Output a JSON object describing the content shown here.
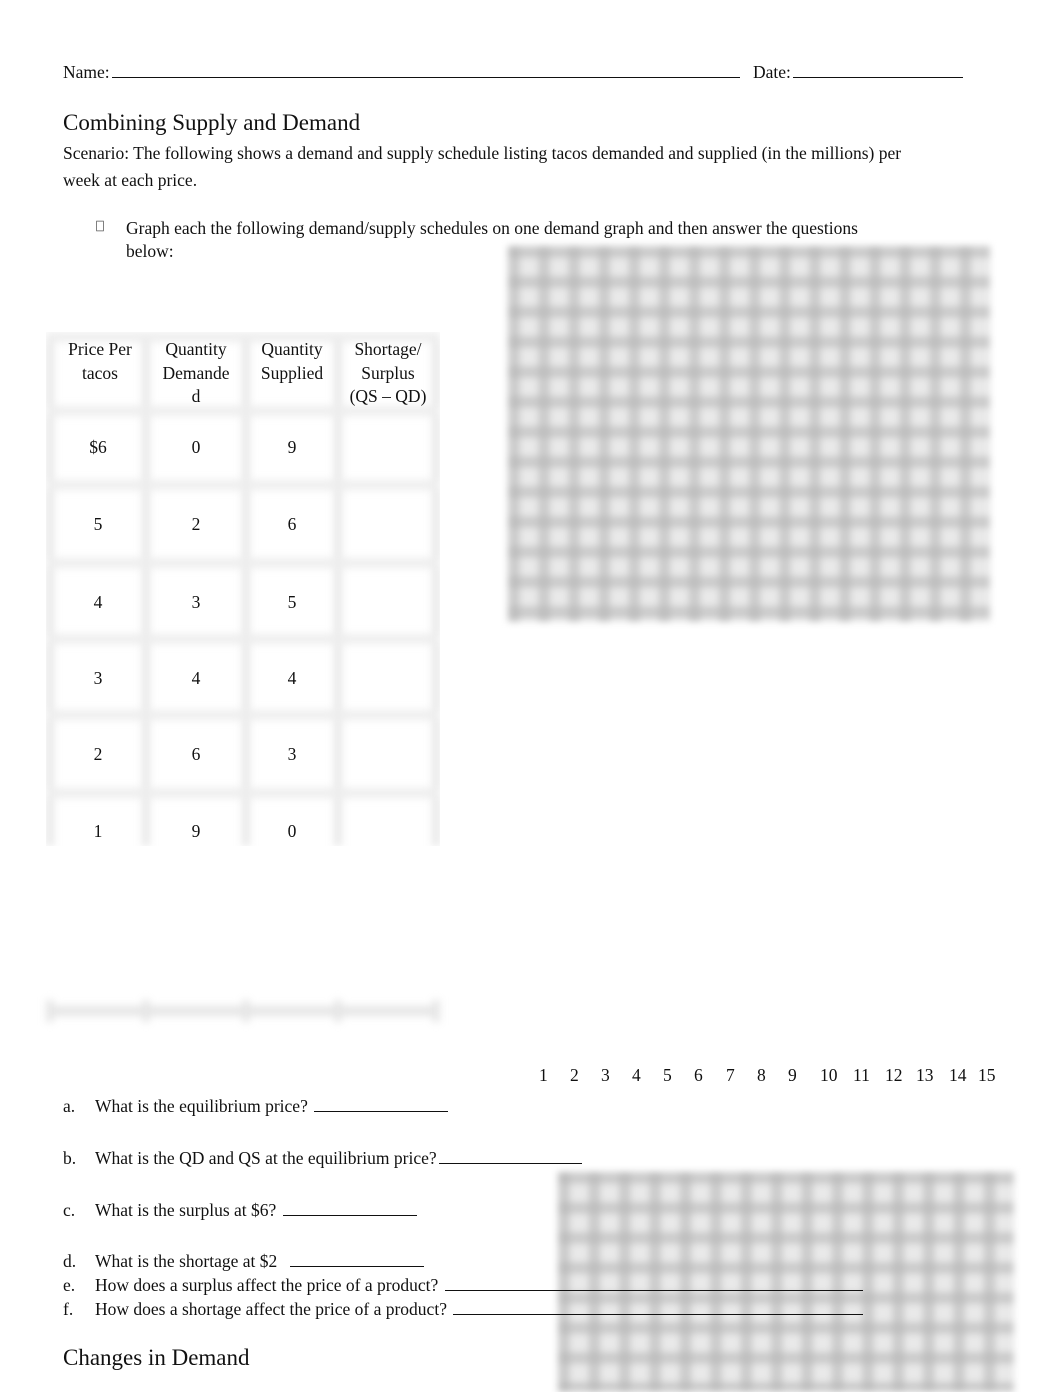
{
  "header": {
    "name_label": "Name:",
    "date_label": "Date:"
  },
  "section1": {
    "title": "Combining Supply and Demand",
    "scenario_line1": "Scenario: The following shows a demand and supply schedule listing tacos demanded and supplied (in the millions) per",
    "scenario_line2": "week at each price.",
    "bullet_icon": "missing-glyph-box",
    "instruction_line1": "Graph each the following demand/supply schedules on one demand graph and then answer the questions",
    "instruction_line2": "below:"
  },
  "table": {
    "headers": [
      [
        "Price Per",
        "tacos"
      ],
      [
        "Quantity",
        "Demande",
        "d"
      ],
      [
        "Quantity",
        "Supplied"
      ],
      [
        "Shortage/",
        "Surplus",
        "(QS – QD)"
      ]
    ],
    "rows": [
      {
        "price": "$6",
        "qd": "0",
        "qs": "9",
        "shortage_surplus": ""
      },
      {
        "price": "5",
        "qd": "2",
        "qs": "6",
        "shortage_surplus": ""
      },
      {
        "price": "4",
        "qd": "3",
        "qs": "5",
        "shortage_surplus": ""
      },
      {
        "price": "3",
        "qd": "4",
        "qs": "4",
        "shortage_surplus": ""
      },
      {
        "price": "2",
        "qd": "6",
        "qs": "3",
        "shortage_surplus": ""
      },
      {
        "price": "1",
        "qd": "9",
        "qs": "0",
        "shortage_surplus": ""
      }
    ]
  },
  "graph": {
    "x_axis_labels": [
      "1",
      "2",
      "3",
      "4",
      "5",
      "6",
      "7",
      "8",
      "9",
      "10",
      "11",
      "12",
      "13",
      "14",
      "15"
    ]
  },
  "questions": [
    {
      "letter": "a.",
      "text": "What is the equilibrium price? "
    },
    {
      "letter": "b.",
      "text": "What is the QD and QS at the equilibrium price?"
    },
    {
      "letter": "c.",
      "text": "What is the surplus at $6? "
    },
    {
      "letter": "d.",
      "text": "What is the shortage at $2  "
    },
    {
      "letter": "e.",
      "text": "How does a surplus affect the price of a product? "
    },
    {
      "letter": "f.",
      "text": "How does a shortage affect the price of a product? "
    }
  ],
  "section2": {
    "title": "Changes in Demand"
  }
}
